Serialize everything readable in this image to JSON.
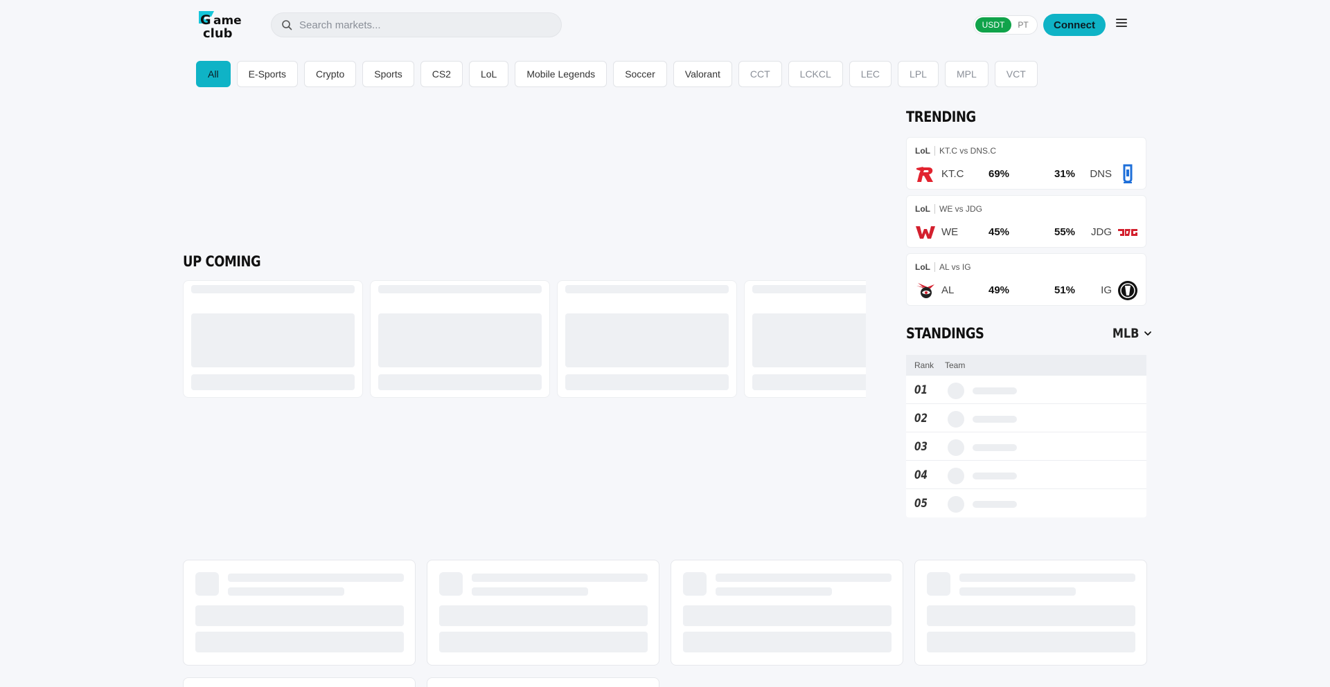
{
  "header": {
    "logo_text": "Game club",
    "search_placeholder": "Search markets...",
    "currency": {
      "active": "USDT",
      "inactive": "PT"
    },
    "connect_label": "Connect"
  },
  "filters": [
    {
      "label": "All",
      "state": "active"
    },
    {
      "label": "E-Sports",
      "state": "normal"
    },
    {
      "label": "Crypto",
      "state": "normal"
    },
    {
      "label": "Sports",
      "state": "normal"
    },
    {
      "label": "CS2",
      "state": "normal"
    },
    {
      "label": "LoL",
      "state": "normal"
    },
    {
      "label": "Mobile Legends",
      "state": "normal"
    },
    {
      "label": "Soccer",
      "state": "normal"
    },
    {
      "label": "Valorant",
      "state": "normal"
    },
    {
      "label": "CCT",
      "state": "muted"
    },
    {
      "label": "LCKCL",
      "state": "muted"
    },
    {
      "label": "LEC",
      "state": "muted"
    },
    {
      "label": "LPL",
      "state": "muted"
    },
    {
      "label": "MPL",
      "state": "muted"
    },
    {
      "label": "VCT",
      "state": "muted"
    }
  ],
  "upcoming": {
    "title": "UP COMING"
  },
  "trending": {
    "title": "TRENDING",
    "matches": [
      {
        "game": "LoL",
        "title": "KT.C vs DNS.C",
        "team_a": "KT.C",
        "pct_a": "69%",
        "pct_b": "31%",
        "team_b": "DNS",
        "logo_a": "kt-logo-icon",
        "logo_b": "dns-logo-icon"
      },
      {
        "game": "LoL",
        "title": "WE vs JDG",
        "team_a": "WE",
        "pct_a": "45%",
        "pct_b": "55%",
        "team_b": "JDG",
        "logo_a": "we-logo-icon",
        "logo_b": "jdg-logo-icon"
      },
      {
        "game": "LoL",
        "title": "AL vs IG",
        "team_a": "AL",
        "pct_a": "49%",
        "pct_b": "51%",
        "team_b": "IG",
        "logo_a": "al-logo-icon",
        "logo_b": "ig-logo-icon"
      }
    ]
  },
  "standings": {
    "title": "STANDINGS",
    "league": "MLB",
    "columns": [
      "Rank",
      "Team"
    ],
    "ranks": [
      "01",
      "02",
      "03",
      "04",
      "05"
    ]
  },
  "colors": {
    "accent": "#0fb3c6",
    "usdt": "#10a34a",
    "background": "#f6f7fa"
  }
}
